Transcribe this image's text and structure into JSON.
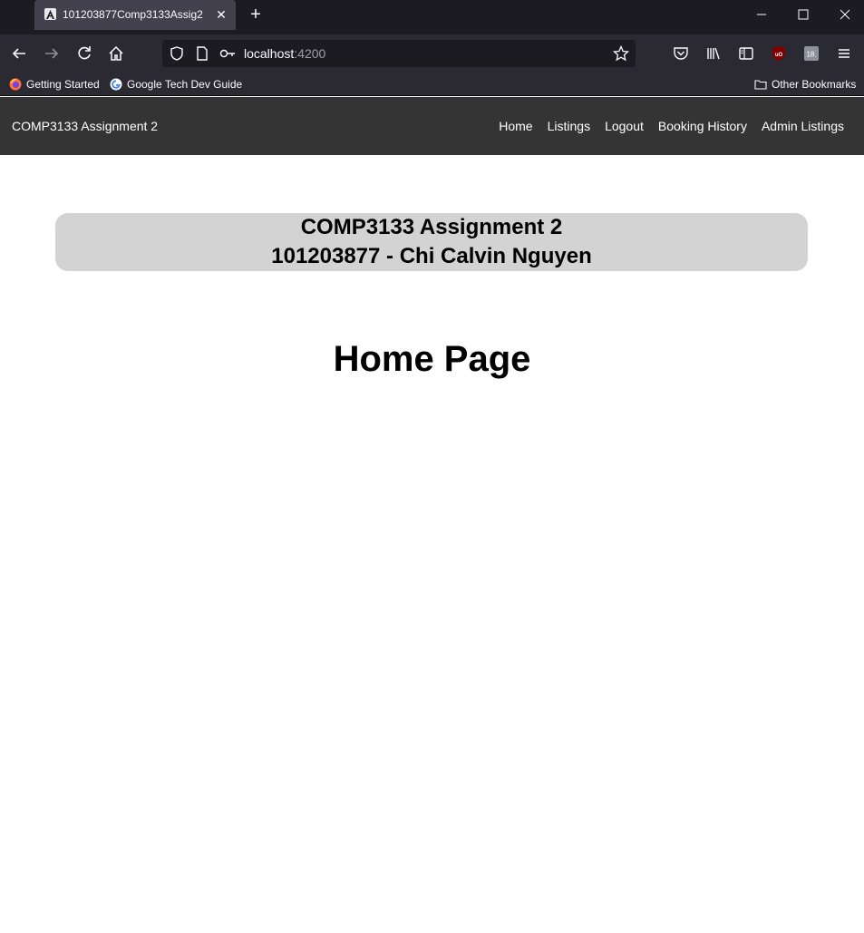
{
  "browser": {
    "tab": {
      "title": "101203877Comp3133Assig2",
      "favicon": "angular-icon"
    },
    "url": {
      "host": "localhost",
      "port": ":4200"
    },
    "bookmarks": [
      {
        "label": "Getting Started",
        "icon": "firefox-icon"
      },
      {
        "label": "Google Tech Dev Guide",
        "icon": "google-icon"
      }
    ],
    "other_bookmarks": "Other Bookmarks",
    "colors": {
      "titlebar": "#1c1b22",
      "toolbar": "#2b2a33",
      "tab": "#42414d"
    }
  },
  "app": {
    "brand": "COMP3133 Assignment 2",
    "menu": [
      "Home",
      "Listings",
      "Logout",
      "Booking History",
      "Admin Listings"
    ],
    "banner": {
      "line1": "COMP3133 Assignment 2",
      "line2": "101203877 - Chi Calvin Nguyen"
    },
    "page_title": "Home Page",
    "colors": {
      "navbar": "#343434",
      "banner": "#d3d3d3"
    }
  }
}
